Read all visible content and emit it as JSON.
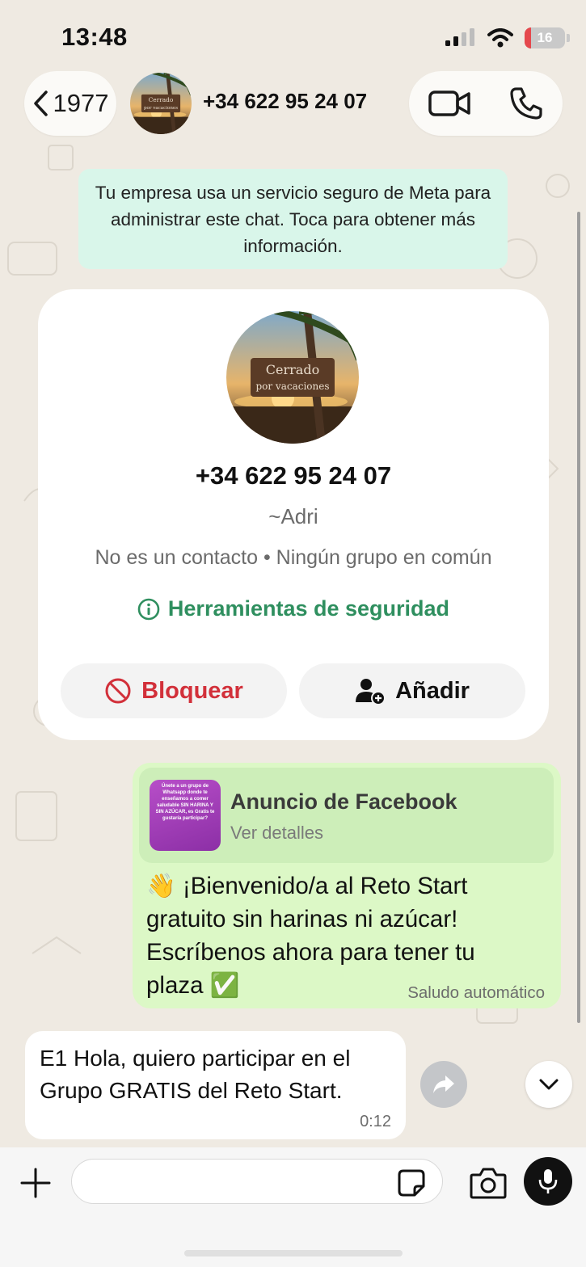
{
  "status_bar": {
    "time": "13:48",
    "battery": "16",
    "battery_level": 0.16
  },
  "header": {
    "back_count": "1977",
    "title": "+34 622 95 24 07",
    "avatar_text_line1": "Cerrado",
    "avatar_text_line2": "por vacaciones"
  },
  "meta_notice": "Tu empresa usa un servicio seguro de Meta para administrar este chat. Toca para obtener más información.",
  "profile": {
    "phone": "+34 622 95 24 07",
    "name": "~Adri",
    "info": "No es un contacto • Ningún grupo en común",
    "safety_tools": "Herramientas de seguridad",
    "block_label": "Bloquear",
    "add_label": "Añadir",
    "avatar_text_line1": "Cerrado",
    "avatar_text_line2": "por vacaciones"
  },
  "ad_message": {
    "ad_title": "Anuncio de Facebook",
    "ad_subtitle": "Ver detalles",
    "thumb_text": "Únete a un grupo de Whatsapp donde te enseñamos a comer saludable SIN HARINA Y SIN AZÚCAR, es Gratis te gustaría participar?",
    "text": "👋 ¡Bienvenido/a al Reto Start gratuito sin harinas ni azúcar! Escríbenos ahora para tener tu plaza ✅",
    "auto_label": "Saludo automático"
  },
  "incoming_message": {
    "text": "E1 Hola, quiero participar en el Grupo GRATIS del Reto Start.",
    "time": "0:12"
  },
  "input_bar": {
    "value": "",
    "placeholder": ""
  },
  "colors": {
    "accent_green": "#2f8f5f",
    "block_red": "#d2303a",
    "bubble_out": "#dcf8c6",
    "notice_bg": "#d9f6ea"
  },
  "icons": [
    "signal-icon",
    "wifi-icon",
    "battery-icon",
    "chevron-left-icon",
    "video-call-icon",
    "phone-icon",
    "info-icon",
    "block-icon",
    "add-contact-icon",
    "forward-icon",
    "chevron-down-icon",
    "plus-icon",
    "sticker-icon",
    "camera-icon",
    "mic-icon"
  ]
}
